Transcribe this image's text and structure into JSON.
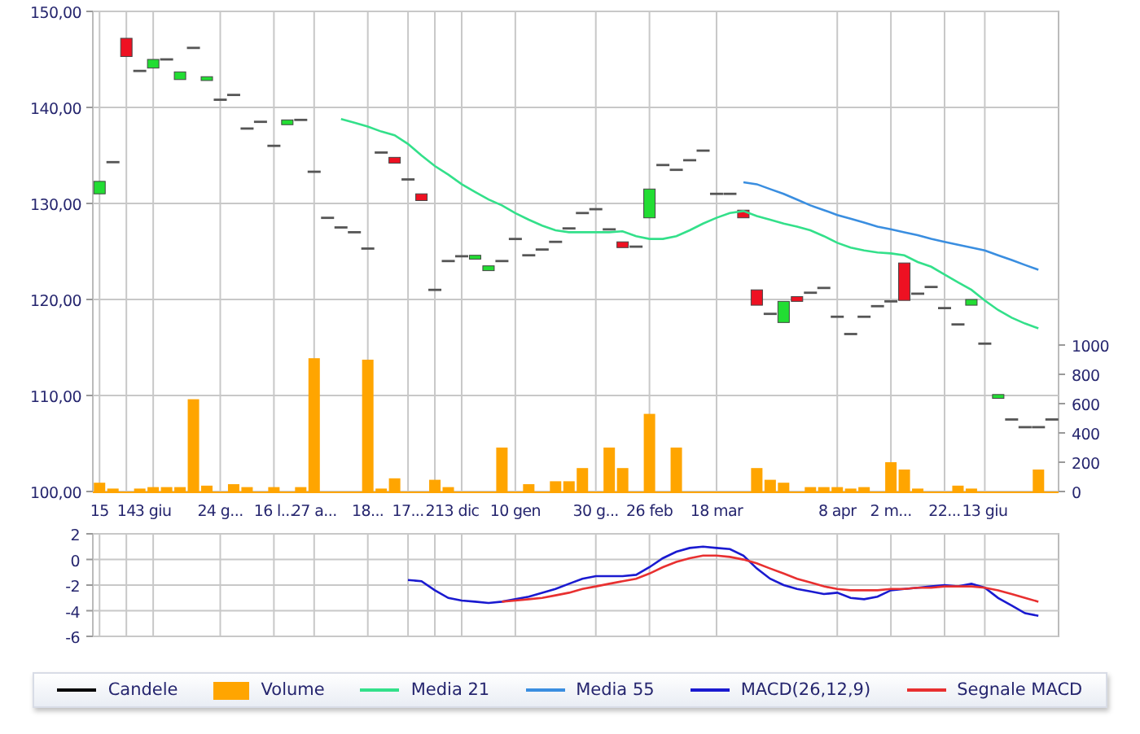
{
  "price_panel": {
    "chart_data": {
      "type": "line",
      "grid": true,
      "ylim": [
        100,
        150
      ],
      "categories": [
        "15",
        null,
        "14",
        null,
        "3 giu",
        null,
        null,
        null,
        null,
        "24 g...",
        null,
        null,
        null,
        "16 l...",
        null,
        null,
        "27 a...",
        null,
        null,
        null,
        "18...",
        null,
        null,
        "17...",
        null,
        "21",
        null,
        "3 dic",
        null,
        null,
        null,
        "10 gen",
        null,
        null,
        null,
        null,
        null,
        "30 g...",
        null,
        null,
        null,
        "26 feb",
        null,
        null,
        null,
        null,
        "18 mar",
        null,
        null,
        null,
        null,
        null,
        null,
        null,
        null,
        "8 apr",
        null,
        null,
        null,
        "2 m...",
        null,
        null,
        null,
        "22...",
        null,
        null,
        "13 giu",
        null,
        null,
        null,
        null,
        null
      ],
      "yticks": [
        {
          "value": 100,
          "label": "100,00"
        },
        {
          "value": 110,
          "label": "110,00"
        },
        {
          "value": 120,
          "label": "120,00"
        },
        {
          "value": 130,
          "label": "130,00"
        },
        {
          "value": 140,
          "label": "140,00"
        },
        {
          "value": 150,
          "label": "150,00"
        }
      ],
      "series": [
        {
          "name": "Media 21",
          "color": "#33e08a",
          "values": [
            null,
            null,
            null,
            null,
            null,
            null,
            null,
            null,
            null,
            null,
            null,
            null,
            null,
            null,
            null,
            null,
            null,
            null,
            138.8,
            138.4,
            138,
            137.5,
            137.1,
            136.2,
            135,
            133.9,
            133,
            132,
            131.2,
            130.4,
            129.8,
            129,
            128.3,
            127.7,
            127.2,
            127,
            127,
            127,
            127,
            127.1,
            126.6,
            126.3,
            126.3,
            126.6,
            127.2,
            127.9,
            128.5,
            129,
            129.2,
            128.7,
            128.3,
            127.9,
            127.6,
            127.2,
            126.6,
            125.9,
            125.4,
            125.1,
            124.9,
            124.8,
            124.6,
            123.9,
            123.4,
            122.6,
            121.8,
            121,
            119.9,
            118.9,
            118.1,
            117.5,
            117,
            null
          ]
        },
        {
          "name": "Media 55",
          "color": "#3a8ee0",
          "values": [
            null,
            null,
            null,
            null,
            null,
            null,
            null,
            null,
            null,
            null,
            null,
            null,
            null,
            null,
            null,
            null,
            null,
            null,
            null,
            null,
            null,
            null,
            null,
            null,
            null,
            null,
            null,
            null,
            null,
            null,
            null,
            null,
            null,
            null,
            null,
            null,
            null,
            null,
            null,
            null,
            null,
            null,
            null,
            null,
            null,
            null,
            null,
            null,
            132.2,
            132,
            131.5,
            131,
            130.4,
            129.8,
            129.3,
            128.8,
            128.4,
            128,
            127.6,
            127.3,
            127,
            126.7,
            126.3,
            126,
            125.7,
            125.4,
            125.1,
            124.6,
            124.1,
            123.6,
            123.1,
            null
          ]
        }
      ]
    }
  },
  "volume_panel": {
    "chart_data": {
      "type": "bar",
      "ylim": [
        0,
        1000
      ],
      "yticks": [
        0,
        200,
        400,
        600,
        800,
        1000
      ],
      "series": [
        {
          "name": "Volume",
          "color": "#ffa500",
          "values": [
            60,
            20,
            0,
            20,
            30,
            30,
            30,
            630,
            40,
            0,
            50,
            30,
            0,
            30,
            0,
            30,
            910,
            0,
            0,
            0,
            900,
            20,
            90,
            0,
            0,
            80,
            30,
            0,
            0,
            0,
            300,
            0,
            50,
            0,
            70,
            70,
            160,
            0,
            300,
            160,
            0,
            530,
            0,
            300,
            0,
            0,
            0,
            0,
            0,
            160,
            80,
            60,
            0,
            30,
            30,
            30,
            20,
            30,
            0,
            200,
            150,
            20,
            0,
            0,
            40,
            20,
            0,
            0,
            0,
            0,
            150,
            0
          ]
        }
      ]
    }
  },
  "macd_panel": {
    "chart_data": {
      "type": "line",
      "grid": true,
      "ylim": [
        -6,
        2
      ],
      "yticks": [
        -6,
        -4,
        -2,
        0,
        2
      ],
      "series": [
        {
          "name": "MACD(26,12,9)",
          "color": "#1a1ad0",
          "values": [
            null,
            null,
            null,
            null,
            null,
            null,
            null,
            null,
            null,
            null,
            null,
            null,
            null,
            null,
            null,
            null,
            null,
            null,
            null,
            null,
            null,
            null,
            null,
            -1.6,
            -1.7,
            -2.4,
            -3.0,
            -3.2,
            -3.3,
            -3.4,
            -3.3,
            -3.1,
            -2.9,
            -2.6,
            -2.3,
            -1.9,
            -1.5,
            -1.3,
            -1.3,
            -1.3,
            -1.2,
            -0.6,
            0.1,
            0.6,
            0.9,
            1.0,
            0.9,
            0.8,
            0.3,
            -0.7,
            -1.5,
            -2.0,
            -2.3,
            -2.5,
            -2.7,
            -2.6,
            -3.0,
            -3.1,
            -2.9,
            -2.4,
            -2.3,
            -2.2,
            -2.1,
            -2.0,
            -2.1,
            -1.9,
            -2.2,
            -3.0,
            -3.6,
            -4.2,
            -4.4,
            null
          ]
        },
        {
          "name": "Segnale MACD",
          "color": "#e83030",
          "values": [
            null,
            null,
            null,
            null,
            null,
            null,
            null,
            null,
            null,
            null,
            null,
            null,
            null,
            null,
            null,
            null,
            null,
            null,
            null,
            null,
            null,
            null,
            null,
            null,
            null,
            null,
            null,
            null,
            null,
            null,
            -3.3,
            -3.2,
            -3.1,
            -3.0,
            -2.8,
            -2.6,
            -2.3,
            -2.1,
            -1.9,
            -1.7,
            -1.5,
            -1.1,
            -0.6,
            -0.2,
            0.1,
            0.3,
            0.3,
            0.2,
            0.0,
            -0.3,
            -0.7,
            -1.1,
            -1.5,
            -1.8,
            -2.1,
            -2.3,
            -2.4,
            -2.4,
            -2.4,
            -2.3,
            -2.3,
            -2.2,
            -2.2,
            -2.1,
            -2.1,
            -2.1,
            -2.2,
            -2.4,
            -2.7,
            -3.0,
            -3.3,
            null
          ]
        }
      ]
    }
  },
  "legend": [
    {
      "label": "Candele",
      "color": "#000000"
    }
  ]
}
